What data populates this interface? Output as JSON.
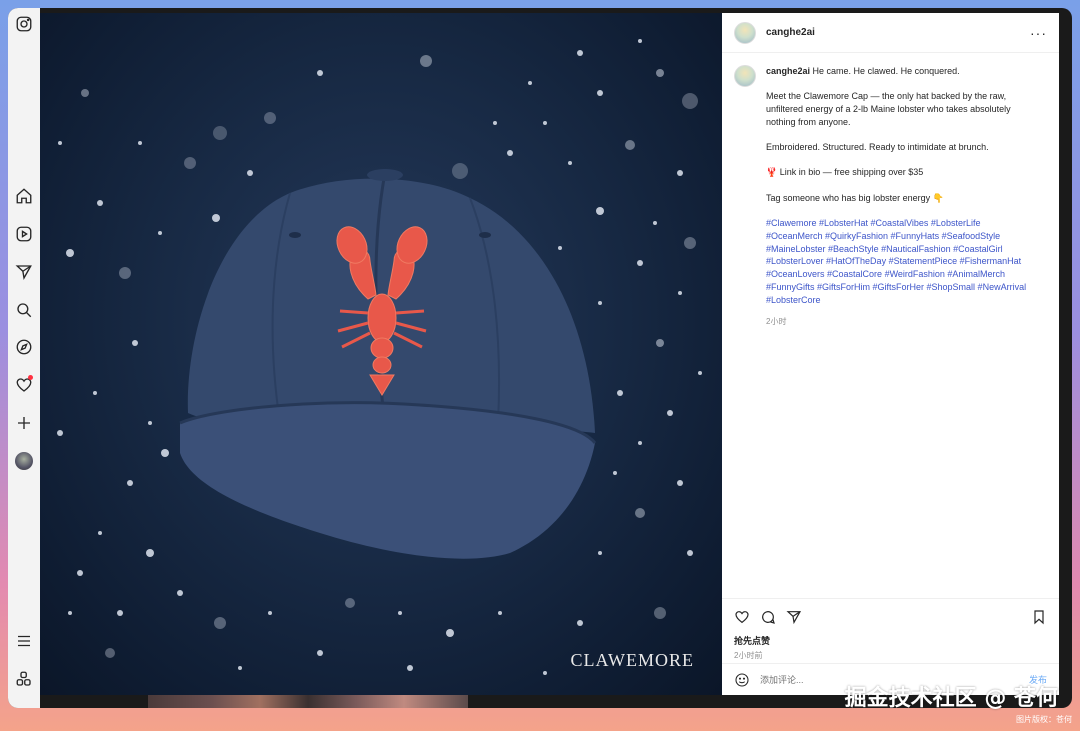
{
  "post": {
    "username": "canghe2ai",
    "more": "···",
    "caption_lead": "He came. He clawed. He conquered.",
    "paragraphs": [
      "Meet the Clawemore Cap — the only hat backed by the raw, unfiltered energy of a 2-lb Maine lobster who takes absolutely nothing from anyone.",
      "Embroidered. Structured. Ready to intimidate at brunch.",
      "🦞 Link in bio — free shipping over $35",
      "Tag someone who has big lobster energy 👇"
    ],
    "hashtags": "#Clawemore #LobsterHat #CoastalVibes #LobsterLife #OceanMerch #QuirkyFashion #FunnyHats #SeafoodStyle #MaineLobster #BeachStyle #NauticalFashion #CoastalGirl #LobsterLover #HatOfTheDay #StatementPiece #FishermanHat #OceanLovers #CoastalCore #WeirdFashion #AnimalMerch #FunnyGifts #GiftsForHim #GiftsForHer #ShopSmall #NewArrival #LobsterCore",
    "caption_time": "2小时",
    "likes_text": "抢先点赞",
    "post_time": "2小时前",
    "comment_placeholder": "添加评论...",
    "post_button": "发布"
  },
  "photo": {
    "brand_text": "CLAWEMORE"
  },
  "watermark": {
    "main": "掘金技术社区 @ 苍何",
    "sub": "图片版权：苍何"
  },
  "colors": {
    "hashtag": "#3d55c9",
    "post_button": "#6aa9f5",
    "photo_bg": "#182a45",
    "lobster": "#e8584a",
    "cap": "#34496d",
    "notification_dot": "#ff3040"
  },
  "icons": {
    "rail": [
      "instagram-icon",
      "home-icon",
      "reels-icon",
      "send-icon",
      "search-icon",
      "explore-icon",
      "heart-icon",
      "create-icon",
      "profile-avatar",
      "menu-icon",
      "apps-icon"
    ],
    "actions": [
      "heart-icon",
      "comment-icon",
      "share-icon",
      "bookmark-icon"
    ],
    "comment": "emoji-icon"
  }
}
